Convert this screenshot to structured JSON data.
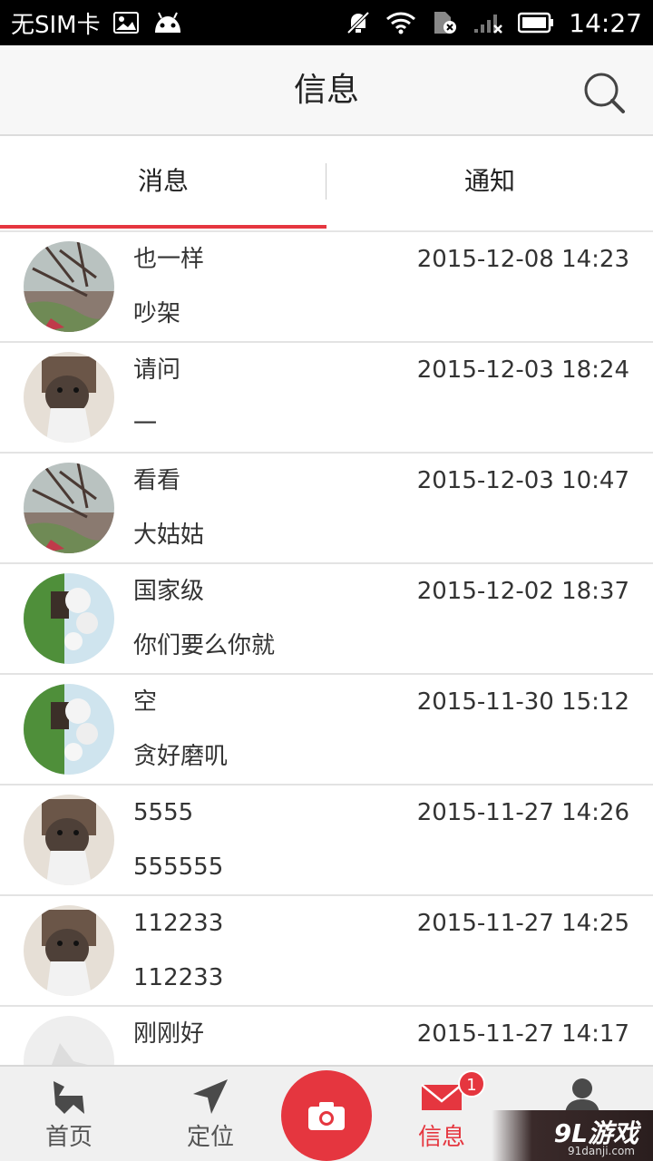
{
  "status_bar": {
    "carrier": "无SIM卡",
    "time": "14:27",
    "icons": [
      "image-icon",
      "android-icon",
      "mute-icon",
      "wifi-icon",
      "sim-error-icon",
      "signal-icon",
      "battery-icon"
    ]
  },
  "header": {
    "title": "信息",
    "search_icon": "search-icon"
  },
  "tabs": [
    {
      "label": "消息",
      "active": true
    },
    {
      "label": "通知",
      "active": false
    }
  ],
  "messages": [
    {
      "name": "也一样",
      "time": "2015-12-08 14:23",
      "text": "吵架",
      "avatar": "tree"
    },
    {
      "name": "请问",
      "time": "2015-12-03 18:24",
      "text": "一",
      "avatar": "dog"
    },
    {
      "name": "看看",
      "time": "2015-12-03 10:47",
      "text": "大姑姑",
      "avatar": "tree"
    },
    {
      "name": "国家级",
      "time": "2015-12-02 18:37",
      "text": "你们要么你就",
      "avatar": "garden"
    },
    {
      "name": "空",
      "time": "2015-11-30 15:12",
      "text": "贪好磨叽",
      "avatar": "garden"
    },
    {
      "name": "5555",
      "time": "2015-11-27 14:26",
      "text": "555555",
      "avatar": "dog"
    },
    {
      "name": "112233",
      "time": "2015-11-27 14:25",
      "text": "112233",
      "avatar": "dog"
    },
    {
      "name": "刚刚好",
      "time": "2015-11-27 14:17",
      "text": "",
      "avatar": "default"
    }
  ],
  "bottom_nav": {
    "items": [
      {
        "label": "首页",
        "icon": "home-icon",
        "active": false
      },
      {
        "label": "定位",
        "icon": "location-icon",
        "active": false
      },
      {
        "label": "",
        "icon": "camera-icon",
        "active": false
      },
      {
        "label": "信息",
        "icon": "mail-icon",
        "active": true
      },
      {
        "label": "",
        "icon": "profile-icon",
        "active": false
      }
    ],
    "badge": "1"
  },
  "watermark": {
    "main": "9L游戏",
    "sub": "91danji.com"
  },
  "colors": {
    "accent": "#e5363f",
    "header_bg": "#f7f7f7",
    "nav_bg": "#f0f0f0"
  }
}
